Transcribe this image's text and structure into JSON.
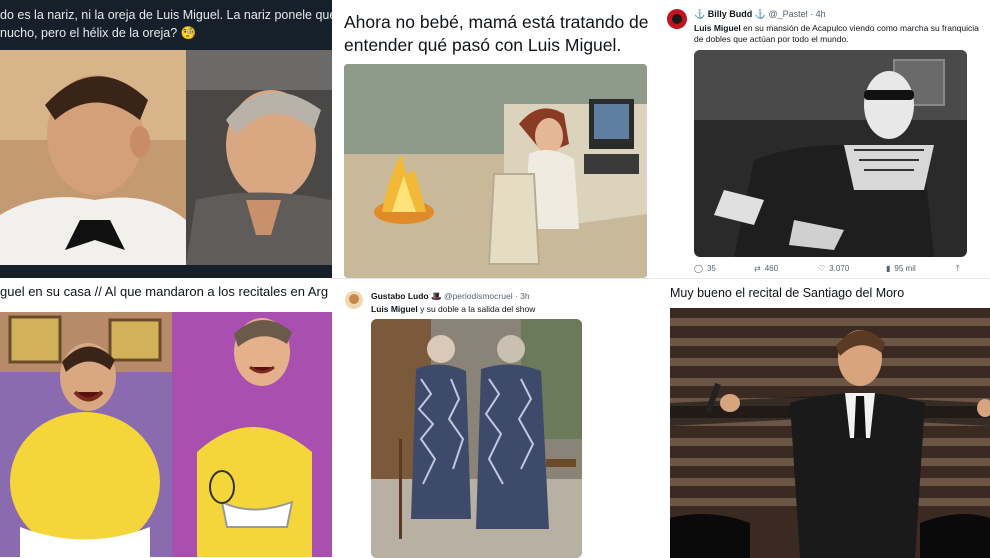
{
  "cells": {
    "top_left": {
      "line1": "do es la nariz, ni la oreja de Luis Miguel. La nariz ponele que se la",
      "line2": "nucho, pero el hélix de la oreja?",
      "emoji": "🧐"
    },
    "top_middle": {
      "line1": "Ahora no bebé, mamá está tratando de",
      "line2": "entender qué pasó con Luis Miguel."
    },
    "top_right": {
      "author": "Billy Budd",
      "handle": "@_Pastel",
      "time": "· 4h",
      "text_bold": "Luis Miguel",
      "text_line1": " en su mansión de Acapulco viendo como marcha su franquicia",
      "text_line2": "de dobles que actúan por todo el mundo.",
      "stats": {
        "replies": "35",
        "retweets": "460",
        "likes": "3.070",
        "views": "95 mil"
      }
    },
    "bottom_left": {
      "caption": "guel en su casa // Al que mandaron a los recitales en Arg"
    },
    "bottom_middle": {
      "author": "Gustabo Ludo",
      "handle": "@periodismocruel",
      "time": "· 3h",
      "text_bold": "Luis Miguel",
      "text_rest": " y su doble a la salida del show"
    },
    "bottom_right": {
      "caption": "Muy bueno el recital de Santiago del Moro"
    }
  },
  "colors": {
    "dark_bg": "#15202b",
    "link_blue": "#1d9bf0",
    "muted": "#536471"
  }
}
